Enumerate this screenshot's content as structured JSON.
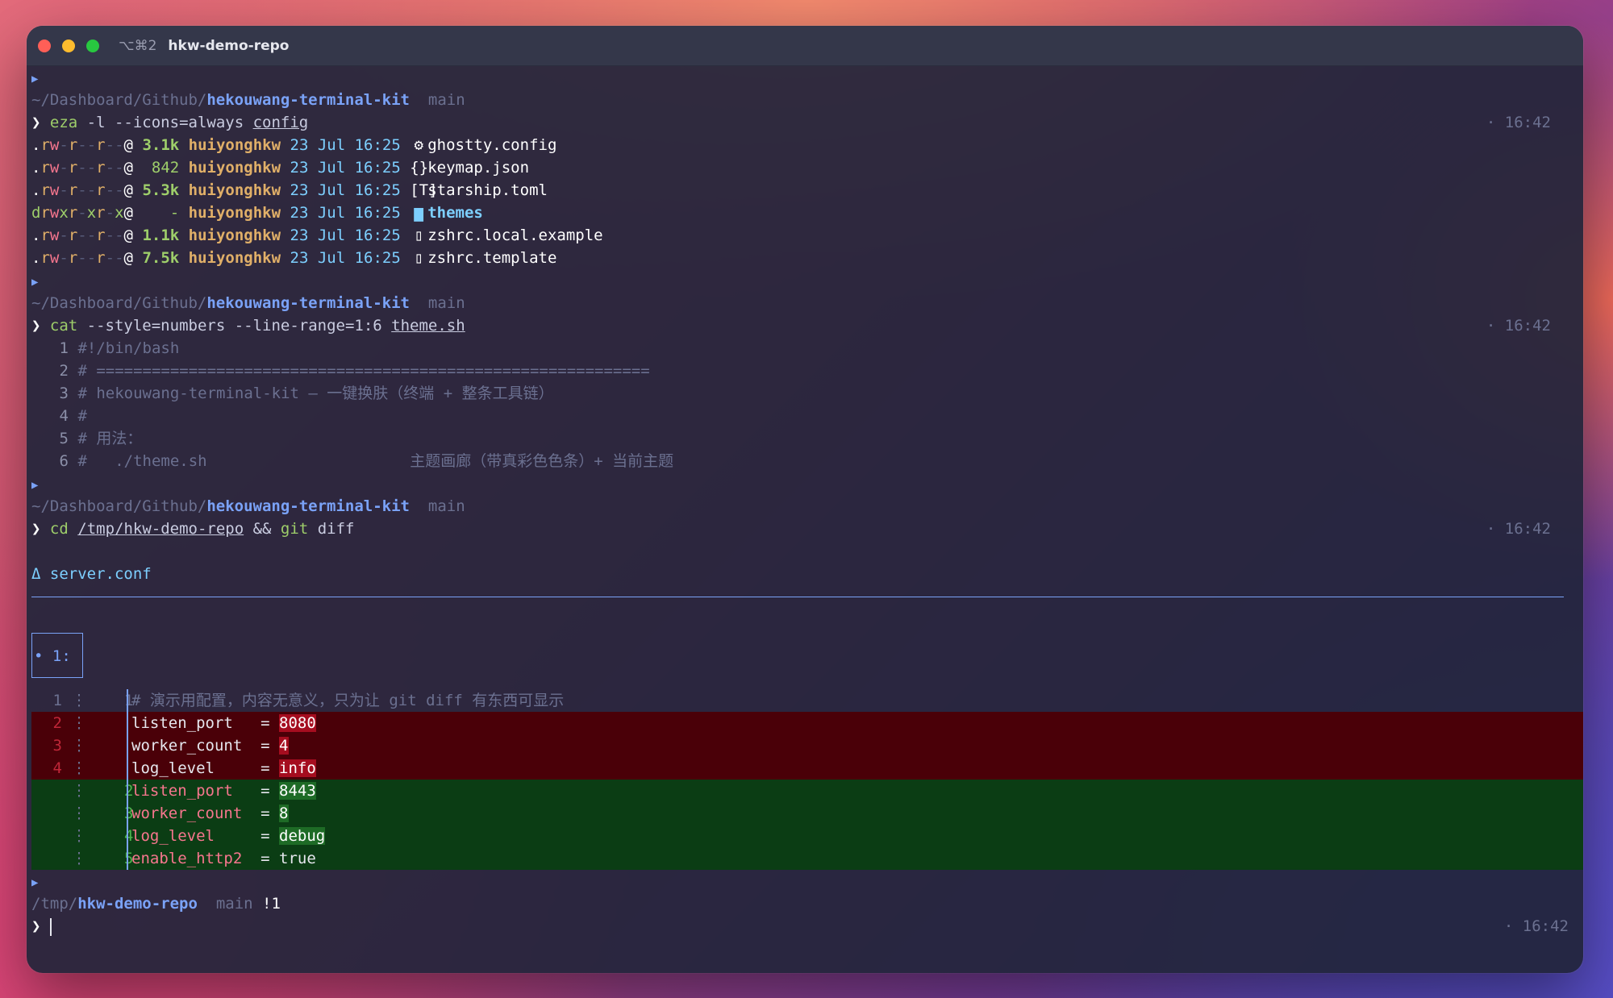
{
  "window": {
    "shortcut": "⌥⌘2",
    "title": "hkw-demo-repo"
  },
  "prompt_symbol": "❯",
  "block1": {
    "path_muted": "~/Dashboard/Github/",
    "path_bold": "hekouwang-terminal-kit",
    "branch": "main",
    "cmd": "eza",
    "args": " -l --icons=always ",
    "arg_ul": "config",
    "time": "· 16:42",
    "files": [
      {
        "perm": ".rw-r--r--@",
        "size": "3.1k",
        "user": "huiyonghkw",
        "date": "23 Jul 16:25",
        "icon": "⚙",
        "name": "ghostty.config",
        "dir": false
      },
      {
        "perm": ".rw-r--r--@",
        "size": " 842",
        "user": "huiyonghkw",
        "date": "23 Jul 16:25",
        "icon": "{}",
        "name": "keymap.json",
        "dir": false
      },
      {
        "perm": ".rw-r--r--@",
        "size": "5.3k",
        "user": "huiyonghkw",
        "date": "23 Jul 16:25",
        "icon": "[T]",
        "name": "starship.toml",
        "dir": false
      },
      {
        "perm": "drwxr-xr-x@",
        "size": "   -",
        "user": "huiyonghkw",
        "date": "23 Jul 16:25",
        "icon": "▆",
        "name": "themes",
        "dir": true
      },
      {
        "perm": ".rw-r--r--@",
        "size": "1.1k",
        "user": "huiyonghkw",
        "date": "23 Jul 16:25",
        "icon": "▯",
        "name": "zshrc.local.example",
        "dir": false
      },
      {
        "perm": ".rw-r--r--@",
        "size": "7.5k",
        "user": "huiyonghkw",
        "date": "23 Jul 16:25",
        "icon": "▯",
        "name": "zshrc.template",
        "dir": false
      }
    ]
  },
  "block2": {
    "path_muted": "~/Dashboard/Github/",
    "path_bold": "hekouwang-terminal-kit",
    "branch": "main",
    "cmd": "cat",
    "args": " --style=numbers --line-range=1:6 ",
    "arg_ul": "theme.sh",
    "time": "· 16:42",
    "lines": [
      {
        "n": "1",
        "text": "#!/bin/bash"
      },
      {
        "n": "2",
        "text": "# ============================================================"
      },
      {
        "n": "3",
        "text": "# hekouwang-terminal-kit — 一键换肤（终端 + 整条工具链）"
      },
      {
        "n": "4",
        "text": "#"
      },
      {
        "n": "5",
        "text": "# 用法："
      },
      {
        "n": "6",
        "text": "#   ./theme.sh                      主题画廊（带真彩色色条）+ 当前主题"
      }
    ]
  },
  "block3": {
    "path_muted": "~/Dashboard/Github/",
    "path_bold": "hekouwang-terminal-kit",
    "branch": "main",
    "cmd": "cd",
    "arg_ul": "/tmp/hkw-demo-repo",
    "and": " && ",
    "cmd2": "git",
    "args2": " diff",
    "time": "· 16:42",
    "file_header": "Δ server.conf",
    "hunk": "• 1:",
    "context": {
      "old": "1",
      "new": "1",
      "text": "# 演示用配置，内容无意义，只为让 git diff 有东西可显示"
    },
    "deleted": [
      {
        "old": "2",
        "key": "listen_port   ",
        "value": "8080"
      },
      {
        "old": "3",
        "key": "worker_count  ",
        "value": "4"
      },
      {
        "old": "4",
        "key": "log_level     ",
        "value": "info"
      }
    ],
    "added": [
      {
        "new": "2",
        "key": "listen_port   ",
        "value": "8443",
        "hl": true
      },
      {
        "new": "3",
        "key": "worker_count  ",
        "value": "8",
        "hl": true
      },
      {
        "new": "4",
        "key": "log_level     ",
        "value": "debug",
        "hl": true
      },
      {
        "new": "5",
        "key": "enable_http2  ",
        "value": "true",
        "hl": false
      }
    ]
  },
  "block4": {
    "path_muted": "/tmp/",
    "path_bold": "hkw-demo-repo",
    "branch": "main",
    "status": "!1",
    "time": "· 16:42"
  }
}
